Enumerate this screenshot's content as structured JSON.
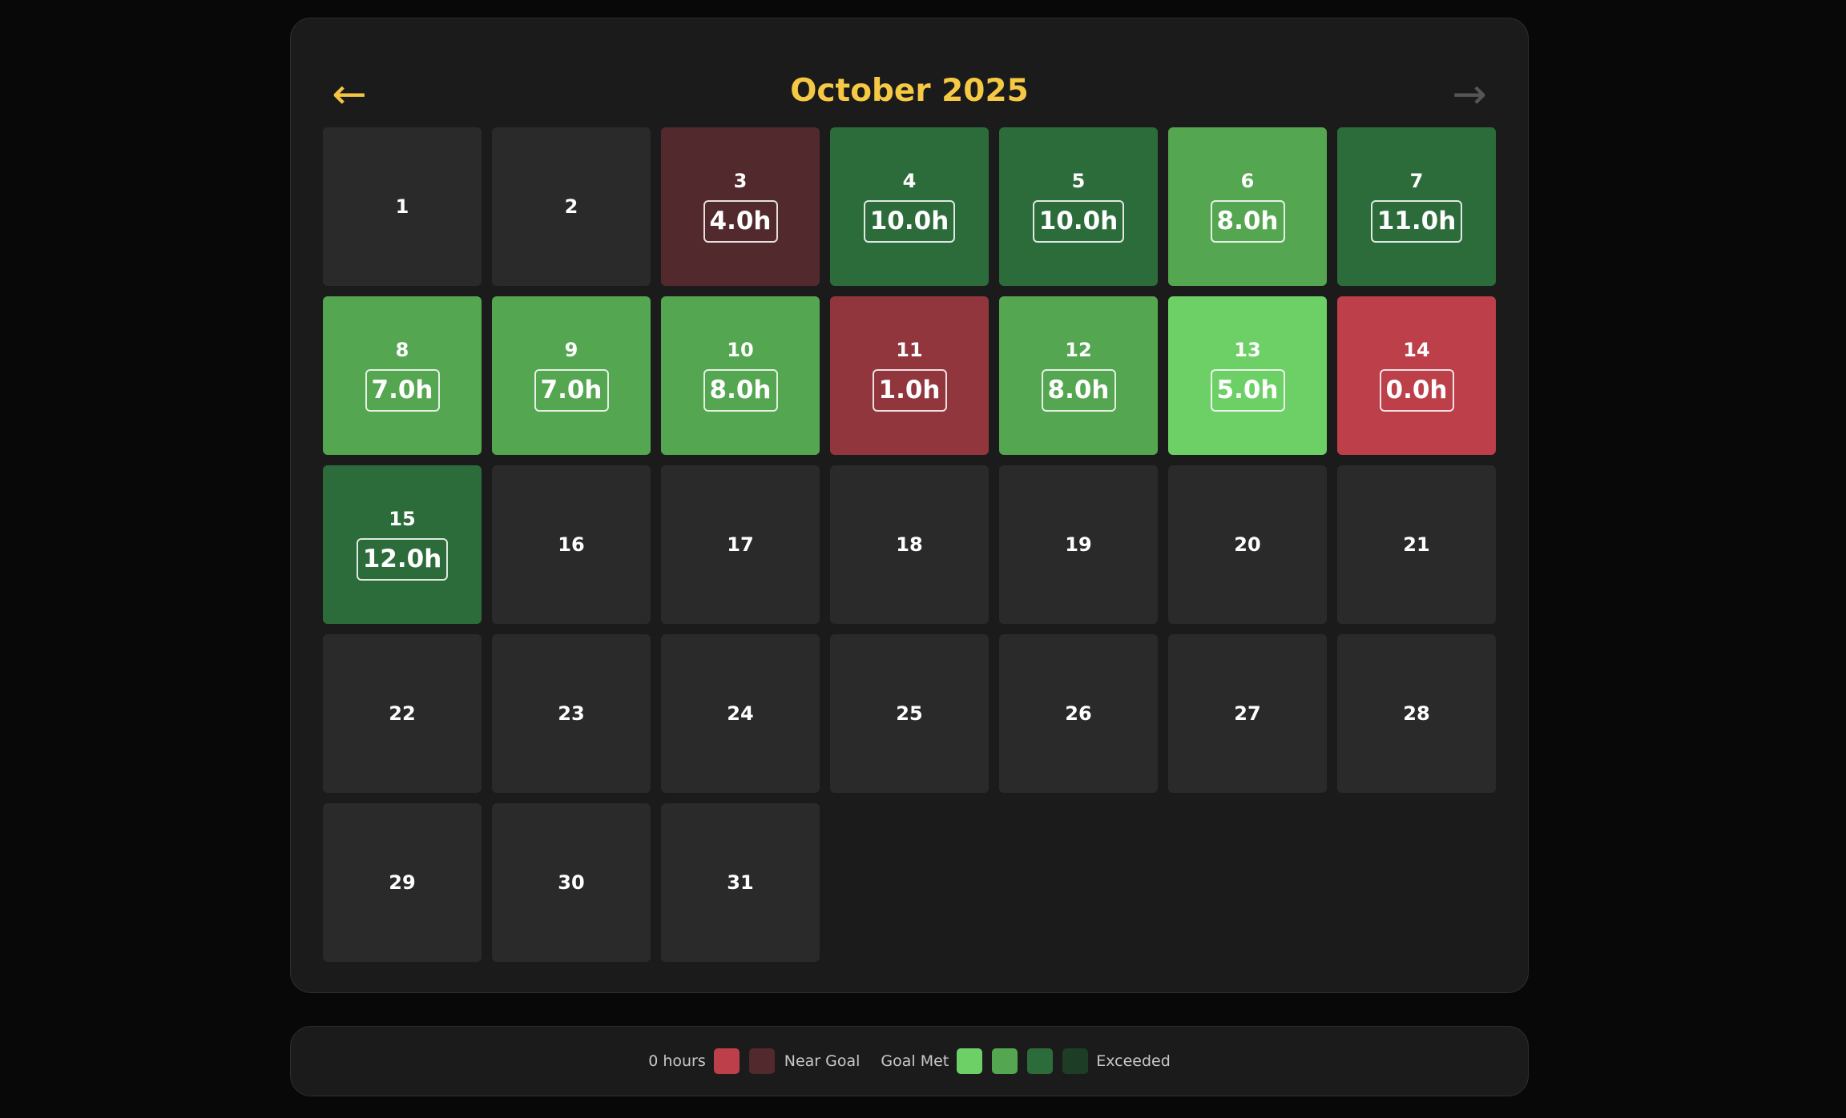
{
  "calendar": {
    "title": "October 2025",
    "prev_icon": "←",
    "next_icon": "→",
    "days": [
      {
        "day": "1",
        "hours": null,
        "color": "#2a2a2a"
      },
      {
        "day": "2",
        "hours": null,
        "color": "#2a2a2a"
      },
      {
        "day": "3",
        "hours": "4.0h",
        "color": "#52292c"
      },
      {
        "day": "4",
        "hours": "10.0h",
        "color": "#2c6c3b"
      },
      {
        "day": "5",
        "hours": "10.0h",
        "color": "#2c6c3b"
      },
      {
        "day": "6",
        "hours": "8.0h",
        "color": "#54a651"
      },
      {
        "day": "7",
        "hours": "11.0h",
        "color": "#2c6c3b"
      },
      {
        "day": "8",
        "hours": "7.0h",
        "color": "#54a651"
      },
      {
        "day": "9",
        "hours": "7.0h",
        "color": "#54a651"
      },
      {
        "day": "10",
        "hours": "8.0h",
        "color": "#54a651"
      },
      {
        "day": "11",
        "hours": "1.0h",
        "color": "#92363d"
      },
      {
        "day": "12",
        "hours": "8.0h",
        "color": "#54a651"
      },
      {
        "day": "13",
        "hours": "5.0h",
        "color": "#6dd067"
      },
      {
        "day": "14",
        "hours": "0.0h",
        "color": "#bc3f49"
      },
      {
        "day": "15",
        "hours": "12.0h",
        "color": "#2c6c3b"
      },
      {
        "day": "16",
        "hours": null,
        "color": "#2a2a2a"
      },
      {
        "day": "17",
        "hours": null,
        "color": "#2a2a2a"
      },
      {
        "day": "18",
        "hours": null,
        "color": "#2a2a2a"
      },
      {
        "day": "19",
        "hours": null,
        "color": "#2a2a2a"
      },
      {
        "day": "20",
        "hours": null,
        "color": "#2a2a2a"
      },
      {
        "day": "21",
        "hours": null,
        "color": "#2a2a2a"
      },
      {
        "day": "22",
        "hours": null,
        "color": "#2a2a2a"
      },
      {
        "day": "23",
        "hours": null,
        "color": "#2a2a2a"
      },
      {
        "day": "24",
        "hours": null,
        "color": "#2a2a2a"
      },
      {
        "day": "25",
        "hours": null,
        "color": "#2a2a2a"
      },
      {
        "day": "26",
        "hours": null,
        "color": "#2a2a2a"
      },
      {
        "day": "27",
        "hours": null,
        "color": "#2a2a2a"
      },
      {
        "day": "28",
        "hours": null,
        "color": "#2a2a2a"
      },
      {
        "day": "29",
        "hours": null,
        "color": "#2a2a2a"
      },
      {
        "day": "30",
        "hours": null,
        "color": "#2a2a2a"
      },
      {
        "day": "31",
        "hours": null,
        "color": "#2a2a2a"
      }
    ]
  },
  "legend": {
    "zero_label": "0 hours",
    "near_label": "Near Goal",
    "met_label": "Goal Met",
    "exceeded_label": "Exceeded",
    "colors": {
      "zero": "#bc3f49",
      "near": "#52292c",
      "met_1": "#6dd067",
      "met_2": "#54a651",
      "met_3": "#2c6c3b",
      "exceeded": "#1e3d26"
    }
  }
}
